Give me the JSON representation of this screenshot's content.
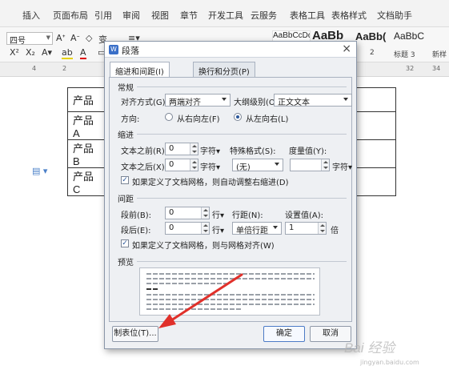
{
  "menubar": {
    "items": [
      "插入",
      "页面布局",
      "引用",
      "审阅",
      "视图",
      "章节",
      "开发工具",
      "云服务",
      "表格工具",
      "表格样式",
      "文档助手"
    ]
  },
  "toolbar": {
    "font_size": "四号",
    "styles": [
      {
        "preview": "AaBbCcDd",
        "label": "2"
      },
      {
        "preview": "AaBb",
        "label": ""
      },
      {
        "preview": "AaBb(",
        "label": "标题 3"
      },
      {
        "preview": "AaBbC",
        "label": "新样"
      }
    ],
    "new_style_label": "新样"
  },
  "ruler": {
    "numbers": [
      "4",
      "2",
      "32",
      "34"
    ]
  },
  "document": {
    "rows": [
      "产品",
      "产品 A",
      "产品 B",
      "产品 C"
    ]
  },
  "dialog": {
    "title": "段落",
    "close": "×",
    "tabs": [
      "缩进和间距(I)",
      "换行和分页(P)"
    ],
    "general": {
      "title": "常规",
      "align_label": "对齐方式(G):",
      "align_value": "两端对齐",
      "outline_label": "大纲级别(O):",
      "outline_value": "正文文本",
      "direction_label": "方向:",
      "dir_rtl": "从右向左(F)",
      "dir_ltr": "从左向右(L)"
    },
    "indent": {
      "title": "缩进",
      "before_label": "文本之前(R):",
      "before_value": "0",
      "before_unit": "字符▾",
      "after_label": "文本之后(X):",
      "after_value": "0",
      "after_unit": "字符▾",
      "special_label": "特殊格式(S):",
      "special_value": "(无)",
      "measure_label": "度量值(Y):",
      "measure_value": "",
      "measure_unit": "字符▾",
      "auto_adjust": "如果定义了文档网格，则自动调整右缩进(D)"
    },
    "spacing": {
      "title": "间距",
      "before_label": "段前(B):",
      "before_value": "0",
      "before_unit": "行▾",
      "after_label": "段后(E):",
      "after_value": "0",
      "after_unit": "行▾",
      "line_label": "行距(N):",
      "line_value": "单倍行距",
      "setting_label": "设置值(A):",
      "setting_value": "1",
      "setting_unit": "倍",
      "snap_grid": "如果定义了文档网格，则与网格对齐(W)"
    },
    "preview": {
      "title": "预览"
    },
    "buttons": {
      "tabs": "制表位(T)...",
      "ok": "确定",
      "cancel": "取消"
    }
  },
  "watermark": {
    "brand": "Bai 经验",
    "url": "jingyan.baidu.com"
  },
  "colors": {
    "annotation_arrow": "#e0302a",
    "accent": "#2b579a"
  }
}
